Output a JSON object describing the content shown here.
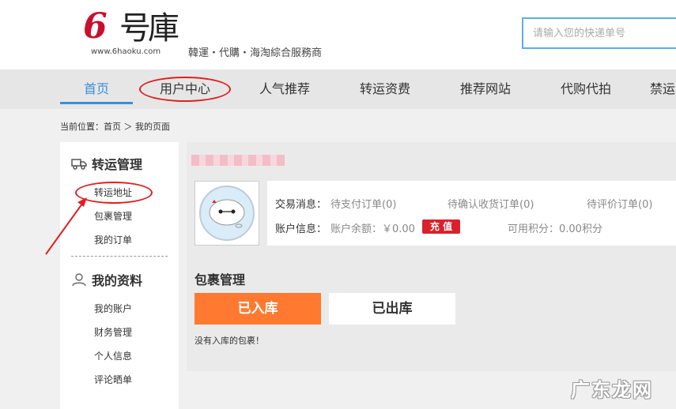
{
  "header": {
    "logo_url_text": "www.6haoku.com",
    "slogan": "韓運・代購・海淘綜合服務商",
    "search_placeholder": "请输入您的快递单号"
  },
  "nav": {
    "items": [
      "首页",
      "用户中心",
      "人气推荐",
      "转运资费",
      "推荐网站",
      "代购代拍",
      "禁运"
    ],
    "active_index": 0
  },
  "breadcrumb": "当前位置：首页 ＞ 我的页面",
  "sidebar": {
    "section1_title": "转运管理",
    "section1_items": [
      "转运地址",
      "包裹管理",
      "我的订单"
    ],
    "section2_title": "我的资料",
    "section2_items": [
      "我的账户",
      "财务管理",
      "个人信息",
      "评论晒单"
    ]
  },
  "account": {
    "trade_label": "交易消息：",
    "pending_pay": "待支付订单(0)",
    "pending_confirm": "待确认收货订单(0)",
    "pending_review": "待评价订单(0)",
    "account_label": "账户信息：",
    "balance": "账户余额：￥0.00",
    "recharge_label": "充 值",
    "points": "可用积分：0.00积分"
  },
  "packages": {
    "title": "包裹管理",
    "tab_in": "已入库",
    "tab_out": "已出库",
    "empty_message": "没有入库的包裹！"
  },
  "watermark": "广东龙网",
  "colors": {
    "accent_blue": "#3a8fd6",
    "brand_red": "#c8102e",
    "orange": "#ff7a30",
    "annotation_red": "#e02020"
  }
}
